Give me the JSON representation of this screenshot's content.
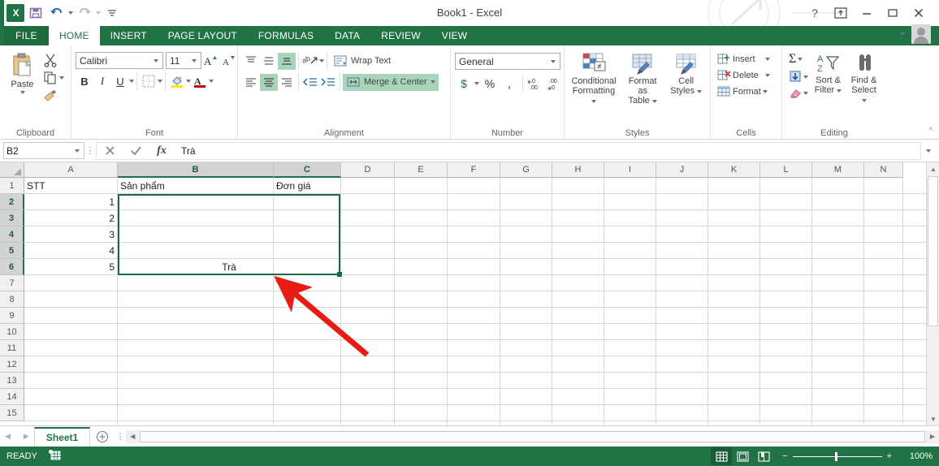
{
  "window": {
    "title": "Book1 - Excel",
    "quick_access": [
      "save-icon",
      "undo-icon",
      "redo-icon",
      "customize-icon"
    ],
    "controls": {
      "help": "?",
      "ribbon_options": "ribbon-display-icon",
      "minimize": "—",
      "restore": "❐",
      "close": "✕"
    }
  },
  "ribbon_tabs": [
    {
      "label": "FILE",
      "active": false,
      "file": true
    },
    {
      "label": "HOME",
      "active": true
    },
    {
      "label": "INSERT",
      "active": false
    },
    {
      "label": "PAGE LAYOUT",
      "active": false
    },
    {
      "label": "FORMULAS",
      "active": false
    },
    {
      "label": "DATA",
      "active": false
    },
    {
      "label": "REVIEW",
      "active": false
    },
    {
      "label": "VIEW",
      "active": false
    }
  ],
  "ribbon": {
    "clipboard": {
      "title": "Clipboard",
      "paste": "Paste",
      "cut": "cut-icon",
      "copy": "copy-icon",
      "format_painter": "format-painter-icon"
    },
    "font": {
      "title": "Font",
      "font_name": "Calibri",
      "font_size": "11",
      "grow": "A",
      "shrink": "A",
      "bold": "B",
      "italic": "I",
      "underline": "U",
      "borders": "borders-icon",
      "fill_color": "fill-color-icon",
      "font_color": "font-color-icon"
    },
    "alignment": {
      "title": "Alignment",
      "wrap_text": "Wrap Text",
      "merge_center": "Merge & Center",
      "align_top": "align-top-icon",
      "align_middle": "align-middle-icon",
      "align_bottom": "align-bottom-icon",
      "orientation": "orientation-icon",
      "align_left": "align-left-icon",
      "align_center": "align-center-icon",
      "align_right": "align-right-icon",
      "decrease_indent": "decrease-indent-icon",
      "increase_indent": "increase-indent-icon"
    },
    "number": {
      "title": "Number",
      "format": "General",
      "accounting": "$",
      "percent": "%",
      "comma": ",",
      "increase_decimal": "increase-decimal-icon",
      "decrease_decimal": "decrease-decimal-icon"
    },
    "styles": {
      "title": "Styles",
      "conditional_formatting": "Conditional\nFormatting",
      "conditional_formatting_l1": "Conditional",
      "conditional_formatting_l2": "Formatting",
      "format_as_table_l1": "Format as",
      "format_as_table_l2": "Table",
      "cell_styles_l1": "Cell",
      "cell_styles_l2": "Styles"
    },
    "cells": {
      "title": "Cells",
      "insert": "Insert",
      "delete": "Delete",
      "format": "Format"
    },
    "editing": {
      "title": "Editing",
      "autosum": "Σ",
      "fill": "fill-icon",
      "clear": "clear-icon",
      "sort_filter_l1": "Sort &",
      "sort_filter_l2": "Filter",
      "find_select_l1": "Find &",
      "find_select_l2": "Select"
    },
    "collapse": "collapse-ribbon-icon"
  },
  "formula_bar": {
    "name_box": "B2",
    "cancel": "cancel-icon",
    "enter": "enter-icon",
    "insert_function": "fx",
    "value": "Trà"
  },
  "grid": {
    "columns": [
      "A",
      "B",
      "C",
      "D",
      "E",
      "F",
      "G",
      "H",
      "I",
      "J",
      "K",
      "L",
      "M",
      "N"
    ],
    "rows": [
      "1",
      "2",
      "3",
      "4",
      "5",
      "6",
      "7",
      "8",
      "9",
      "10",
      "11",
      "12",
      "13",
      "14",
      "15"
    ],
    "selected_columns": [
      "B",
      "C"
    ],
    "selected_rows": [
      "2",
      "3",
      "4",
      "5",
      "6"
    ],
    "cells": [
      {
        "ref": "A1",
        "col": 0,
        "row": 0,
        "value": "STT",
        "align": "left"
      },
      {
        "ref": "B1",
        "col": 1,
        "row": 0,
        "value": "Sản phẩm",
        "align": "left"
      },
      {
        "ref": "C1",
        "col": 2,
        "row": 0,
        "value": "Đơn giá",
        "align": "left"
      },
      {
        "ref": "A2",
        "col": 0,
        "row": 1,
        "value": "1",
        "align": "right"
      },
      {
        "ref": "A3",
        "col": 0,
        "row": 2,
        "value": "2",
        "align": "right"
      },
      {
        "ref": "A4",
        "col": 0,
        "row": 3,
        "value": "3",
        "align": "right"
      },
      {
        "ref": "A5",
        "col": 0,
        "row": 4,
        "value": "4",
        "align": "right"
      },
      {
        "ref": "A6",
        "col": 0,
        "row": 5,
        "value": "5",
        "align": "right"
      }
    ],
    "merged_selection": {
      "ref": "B2:C6",
      "value": "Trà"
    }
  },
  "sheet_tabs": {
    "tabs": [
      "Sheet1"
    ],
    "active": "Sheet1",
    "add": "+",
    "prev": "◀",
    "next": "▶"
  },
  "status_bar": {
    "mode": "READY",
    "macro": "record-macro-icon",
    "views": [
      "normal-view-icon",
      "page-layout-view-icon",
      "page-break-view-icon"
    ],
    "active_view": "normal-view-icon",
    "zoom_out": "−",
    "zoom_in": "+",
    "zoom": "100%"
  },
  "annotation": {
    "type": "red-arrow",
    "points_to": "B2:C6",
    "color": "#e81c14"
  },
  "colors": {
    "excel_green": "#217346",
    "selection_green": "#1b6b42",
    "highlight": "#a8d5ba"
  }
}
